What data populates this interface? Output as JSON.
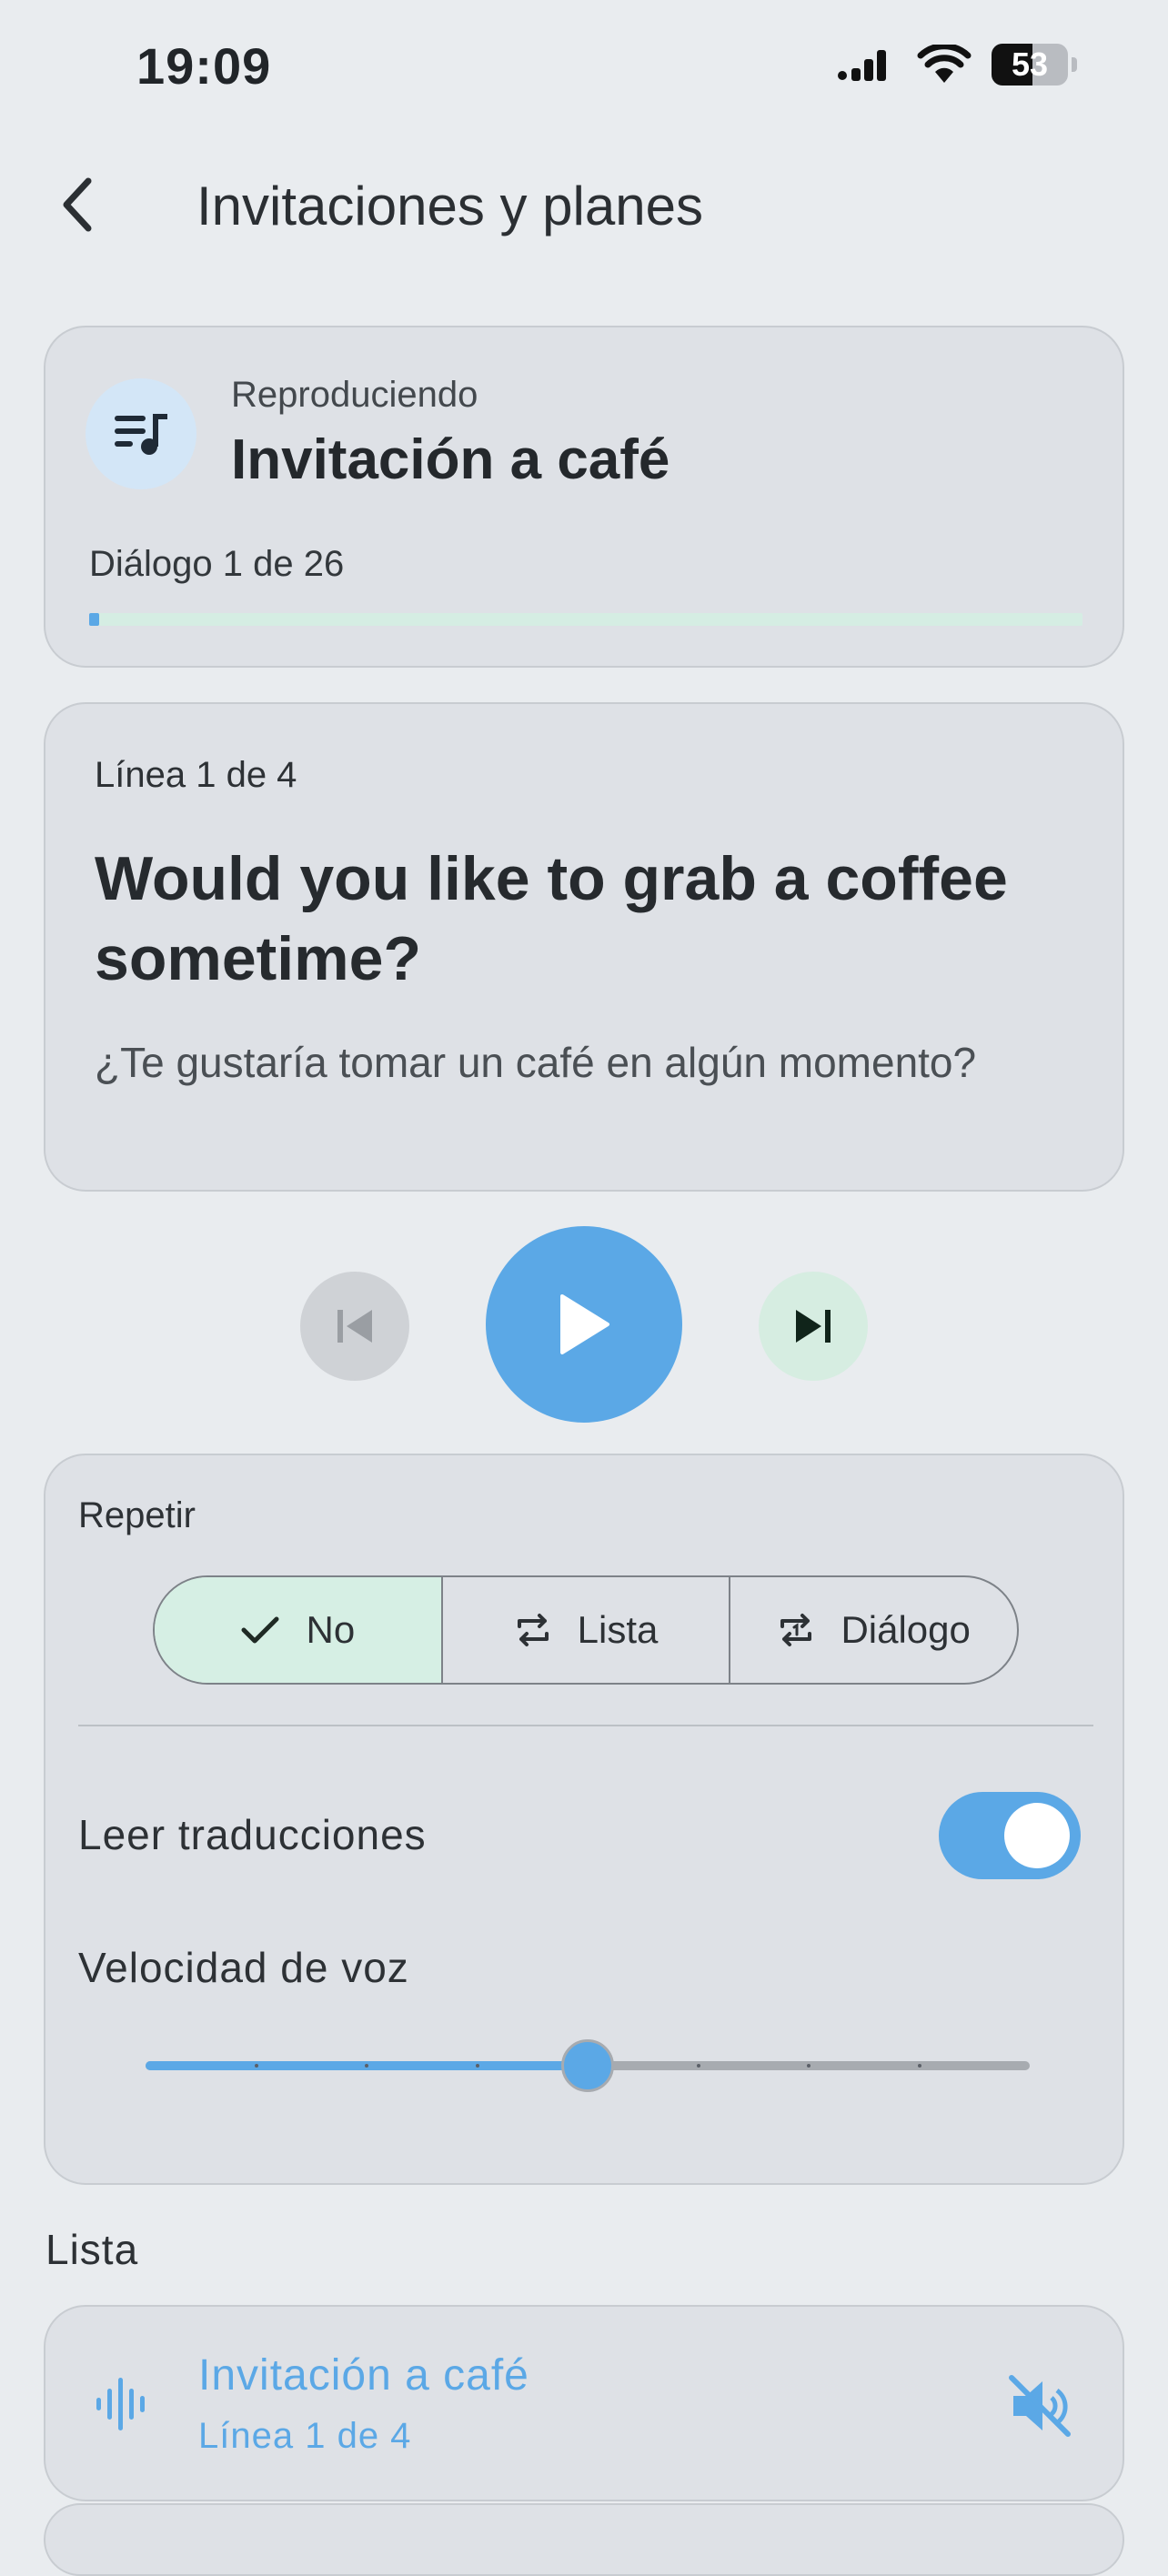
{
  "status_bar": {
    "time": "19:09",
    "battery": "53"
  },
  "header": {
    "title": "Invitaciones y planes"
  },
  "now_playing": {
    "label": "Reproduciendo",
    "title": "Invitación a café",
    "dialog_count": "Diálogo 1 de 26",
    "progress_fraction": 0.01
  },
  "current_line": {
    "count": "Línea 1 de 4",
    "text": "Would you like to grab a coffee sometime?",
    "translation": "¿Te gustaría tomar un café en algún momento?"
  },
  "repeat": {
    "label": "Repetir",
    "options": [
      "No",
      "Lista",
      "Diálogo"
    ],
    "selected": "No"
  },
  "read_translations": {
    "label": "Leer traducciones",
    "enabled": true
  },
  "voice_speed": {
    "label": "Velocidad de voz",
    "steps": 9,
    "value_step": 4
  },
  "list": {
    "heading": "Lista",
    "items": [
      {
        "title": "Invitación a café",
        "subtitle": "Línea 1 de 4"
      }
    ]
  },
  "colors": {
    "accent": "#5ba8e6",
    "active_segment": "#d6efe4",
    "card": "#dee1e6"
  }
}
